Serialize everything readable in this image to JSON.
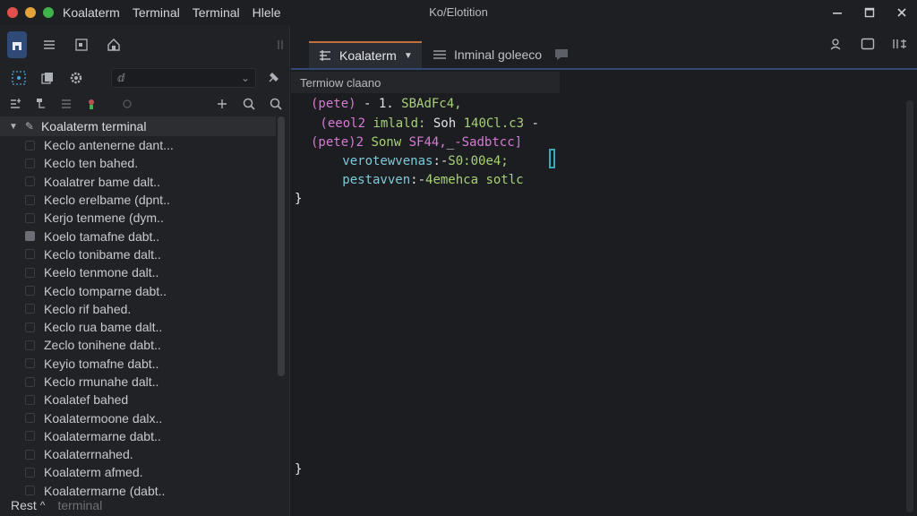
{
  "titlebar": {
    "traffic_colors": [
      "#e0504c",
      "#e6a23a",
      "#3fb24a"
    ],
    "menu": [
      "Koalaterm",
      "Terminal",
      "Terminal",
      "Hlele"
    ],
    "window_title": "Ko/Elotition"
  },
  "toolbar": {
    "select_value": "ⅆ"
  },
  "tree": {
    "header": "Koalaterm terminal",
    "items": [
      {
        "label": "Keclo antenerne dant..."
      },
      {
        "label": "Keclo ten bahed."
      },
      {
        "label": "Koalatrer bame dalt.."
      },
      {
        "label": "Keclo erelbame (dpnt.."
      },
      {
        "label": "Kerjo tenmene (dym.."
      },
      {
        "label": "Koelo tamafne dabt.."
      },
      {
        "label": "Keclo tonibame dalt.."
      },
      {
        "label": "Keelo tenmone dalt.."
      },
      {
        "label": "Keclo tomparne dabt.."
      },
      {
        "label": "Keclo rif bahed."
      },
      {
        "label": "Keclo rua bame dalt.."
      },
      {
        "label": "Zeclo tonihene dabt.."
      },
      {
        "label": "Keyio tomafne dabt.."
      },
      {
        "label": "Keclo rmunahe dalt.."
      },
      {
        "label": "Koalatef bahed"
      },
      {
        "label": "Koalatermoone dalx.."
      },
      {
        "label": "Koalatermarne dabt.."
      },
      {
        "label": "Koalaterrnahed."
      },
      {
        "label": "Koalaterm afmed."
      },
      {
        "label": "Koalatermarne (dabt.."
      }
    ],
    "filled_index": 5
  },
  "status": {
    "label": "Rest",
    "chevron": "^",
    "faded": "terminal"
  },
  "tabs": {
    "active": "Koalaterm",
    "second": "Inminal goleeco"
  },
  "subheader": "Termiow claano",
  "code": [
    {
      "segments": [
        {
          "t": "(pete)",
          "c": "c-pink"
        },
        {
          "t": " - 1. ",
          "c": "c-white"
        },
        {
          "t": "SBAdFc4,",
          "c": "c-green"
        }
      ]
    },
    {
      "segments": [
        {
          "t": " (eeol2 ",
          "c": "c-pink"
        },
        {
          "t": "imlald: ",
          "c": "c-green"
        },
        {
          "t": "Soh ",
          "c": "c-white"
        },
        {
          "t": "140Cl.c3",
          "c": "c-green"
        },
        {
          "t": " -",
          "c": "c-white"
        }
      ]
    },
    {
      "segments": [
        {
          "t": "(pete)2 ",
          "c": "c-pink"
        },
        {
          "t": "Sonw ",
          "c": "c-green"
        },
        {
          "t": "SF44,",
          "c": "c-pink"
        },
        {
          "t": "_",
          "c": "c-white"
        },
        {
          "t": "-Sadbtcc]",
          "c": "c-pink"
        }
      ]
    },
    {
      "segments": [
        {
          "t": "   verotewvenas",
          "c": "c-cyan"
        },
        {
          "t": ":-",
          "c": "c-white"
        },
        {
          "t": "S0:00e4;",
          "c": "c-green"
        }
      ]
    },
    {
      "segments": [
        {
          "t": "   pestavven",
          "c": "c-cyan"
        },
        {
          "t": ":-",
          "c": "c-white"
        },
        {
          "t": "4emehca ",
          "c": "c-green"
        },
        {
          "t": "sotlc",
          "c": "c-green"
        }
      ]
    },
    {
      "segments": [
        {
          "t": "}",
          "c": "c-brace"
        }
      ]
    }
  ],
  "closing_brace": "}"
}
